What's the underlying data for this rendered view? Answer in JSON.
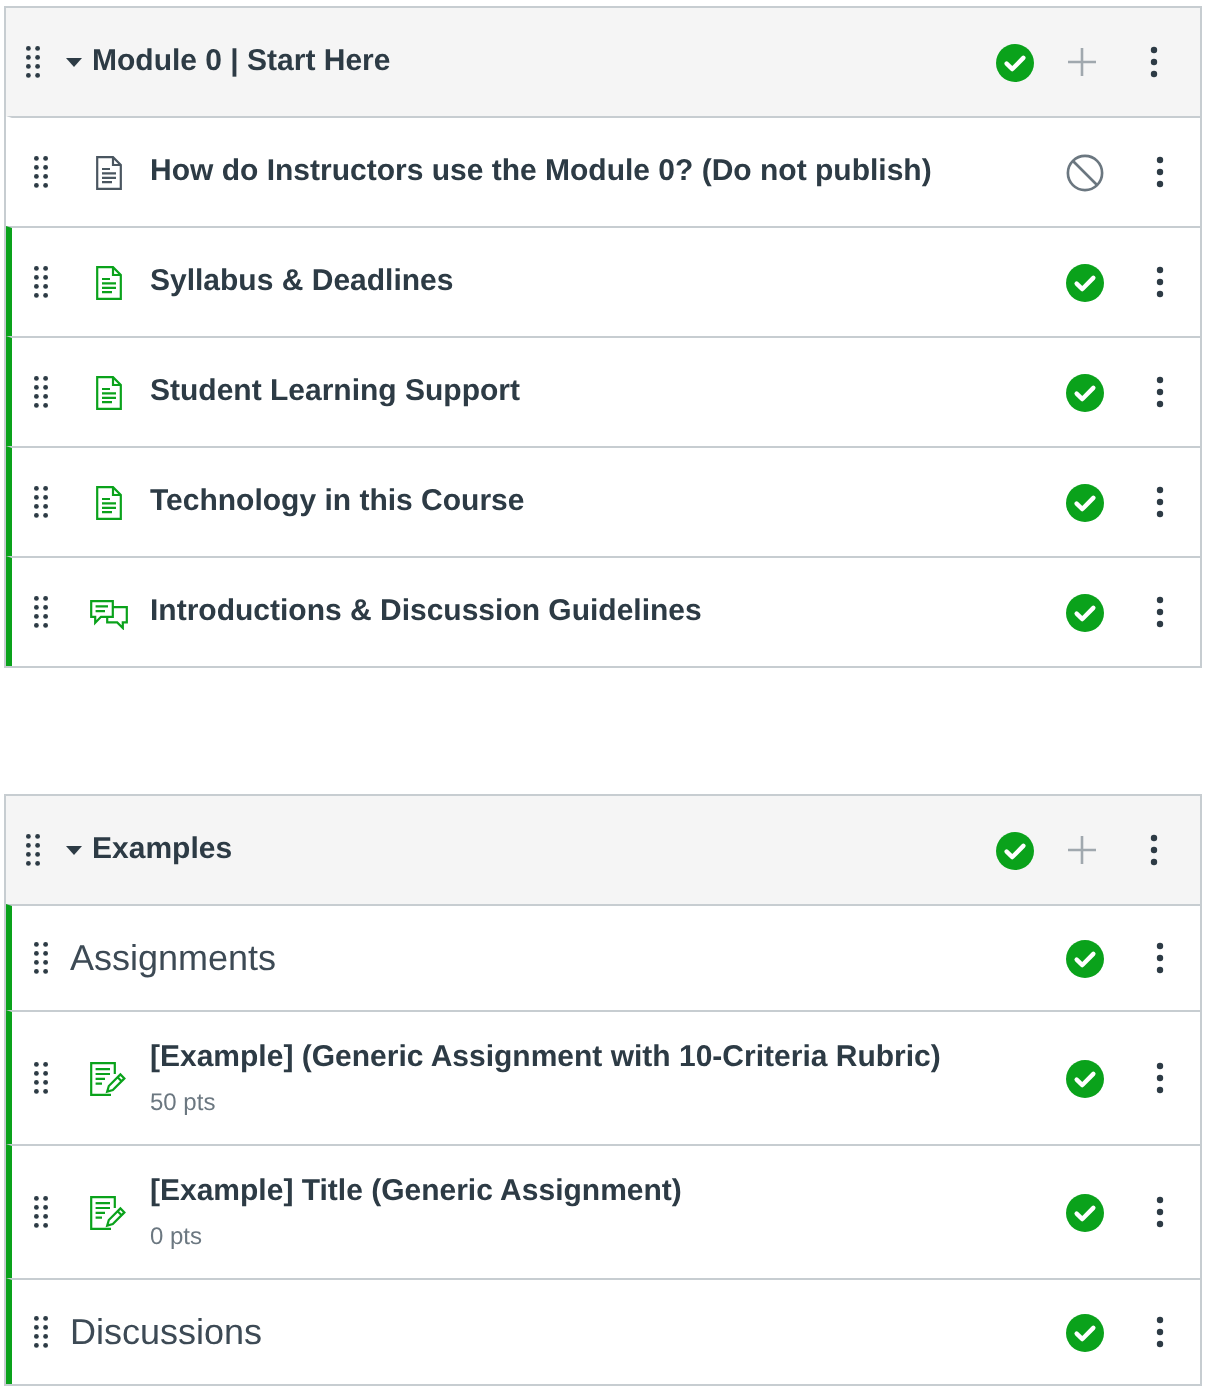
{
  "modules": [
    {
      "title": "Module 0 | Start Here",
      "expanded": true,
      "published": true,
      "items": [
        {
          "kind": "page",
          "title": "How do Instructors use the Module 0? (Do not publish)",
          "published": false
        },
        {
          "kind": "page",
          "title": "Syllabus & Deadlines",
          "published": true
        },
        {
          "kind": "page",
          "title": "Student Learning Support",
          "published": true
        },
        {
          "kind": "page",
          "title": "Technology in this Course",
          "published": true
        },
        {
          "kind": "discussion",
          "title": "Introductions & Discussion Guidelines",
          "published": true
        }
      ]
    },
    {
      "title": "Examples",
      "expanded": true,
      "published": true,
      "items": [
        {
          "kind": "header",
          "title": "Assignments",
          "published": true
        },
        {
          "kind": "assignment",
          "title": "[Example] (Generic Assignment with 10-Criteria Rubric)",
          "points": "50 pts",
          "published": true
        },
        {
          "kind": "assignment",
          "title": "[Example] Title (Generic Assignment)",
          "points": "0 pts",
          "published": true
        },
        {
          "kind": "header",
          "title": "Discussions",
          "published": true
        }
      ]
    }
  ]
}
